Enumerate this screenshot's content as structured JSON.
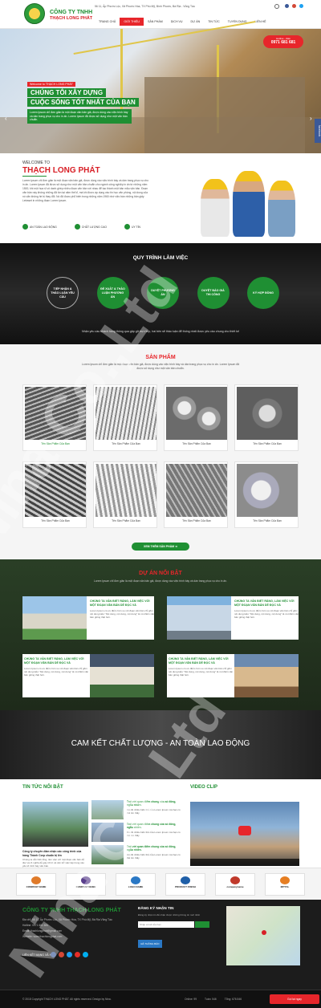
{
  "header": {
    "brand_line1": "CÔNG TY TNHH",
    "brand_line2": "THẠCH LONG PHÁT",
    "address": "56 11, Ấp Phước Lộc, Xã Phước Hòa, TX Phú Mỹ, Bình Phước, Bà Rịa - Vũng Tàu",
    "nav": [
      "TRANG CHỦ",
      "GIỚI THIỆU",
      "SẢN PHẨM",
      "DỊCH VỤ",
      "DỰ ÁN",
      "TIN TỨC",
      "TUYỂN DỤNG",
      "LIÊN HỆ"
    ]
  },
  "hero": {
    "hotline_label": "Hotline - Zalo",
    "hotline_number": "0971 681 681",
    "welcome": "Welcome to THẠCH LONG PHÁT",
    "title1": "CHÚNG TÔI XÂY DỰNG",
    "title2": "CUỘC SỐNG TỐT NHẤT CỦA BẠN",
    "desc": "Lorem Ipsum chỉ đơn giản là một đoạn văn bản giả, được dùng vào việc trình bày và dàn trang phục vụ cho in ấn. Lorem Ipsum đã được sử dụng như một văn bản chuẩn.",
    "facebook_tab": "facebook"
  },
  "welcome": {
    "sub": "WELCOME TO",
    "title": "THẠCH LONG PHÁT",
    "text": "Lorem Ipsum chỉ đơn giản là một đoạn văn bản giả, được dùng vào việc trình bày và dàn trang phục vụ cho in ấn. Lorem Ipsum đã được sử dụng như một văn bản chuẩn cho ngành công nghiệp in ấn từ những năm 1500, khi một họa sĩ vô danh ghép nhiều đoạn văn bản với nhau để tạo thành một bản mẫu văn bản. Đoạn văn bản này không những đã tồn tại năm thế kỉ, mà khi được áp dụng vào tin học văn phòng, nội dung của nó vẫn không hề bị thay đổi. Nó đã được phổ biến trong những năm 1960 nhờ việc bán những bản giấy Letraset in những đoạn Lorem Ipsum.",
    "icons": [
      "AN TOÀN LAO ĐỘNG",
      "CHẤT LƯỢNG CAO",
      "UY TÍN"
    ]
  },
  "process": {
    "title": "QUY TRÌNH LÀM VIỆC",
    "steps": [
      "TIẾP NHẬN & THẢO LUẬN YÊU CẦU",
      "ĐỀ XUẤT & THẢO LUẬN PHƯƠNG ÁN",
      "DUYỆT PHƯƠNG ÁN",
      "DUYỆT BÁO GIÁ THI CÔNG",
      "KÝ HỢP ĐỒNG"
    ],
    "note": "Nhận yêu cầu khách hàng thông qua gặp gỡ trực tiếp, hai bên sẽ thảo luận để thống nhất được yêu cầu chung cho thiết kế"
  },
  "products": {
    "title": "SẢN PHẨM",
    "desc": "Lorem Ipsum chỉ đơn giản là một đoạn văn bản giả, được dùng vào việc trình bày và dàn trang phục vụ cho in ấn. Lorem Ipsum đã được sử dụng như một văn bản chuẩn.",
    "items": [
      "Tên Sản Phẩm Của Bạn",
      "Tên Sản Phẩm Của Bạn",
      "Tên Sản Phẩm Của Bạn",
      "Tên Sản Phẩm Của Bạn",
      "Tên Sản Phẩm Của Bạn",
      "Tên Sản Phẩm Của Bạn",
      "Tên Sản Phẩm Của Bạn",
      "Tên Sản Phẩm Của Bạn"
    ],
    "button": "XEM THÊM SẢN PHẨM ➜"
  },
  "projects": {
    "title": "DỰ ÁN NỔI BẬT",
    "desc": "Lorem Ipsum chỉ đơn giản là một đoạn văn bản giả, được dùng vào việc trình bày và dàn trang phục vụ cho in ấn.",
    "items": [
      {
        "title": "CHÚNG TA VẪN BIẾT RẰNG, LÀM VIỆC VỚI MỘT ĐOẠN VĂN BẢN DỄ ĐỌC VÀ",
        "desc": "Lorem Ipsum có ưu điểm hơn so với đoạn văn bản chỉ gồm nội dung kiểu \"Nội dung, nội dung, nội dung\" là nó khiến văn bản giống thật hơn.",
        "button": "Xem Thêm"
      },
      {
        "title": "CHÚNG TA VẪN BIẾT RẰNG, LÀM VIỆC VỚI MỘT ĐOẠN VĂN BẢN DỄ ĐỌC VÀ",
        "desc": "Lorem Ipsum có ưu điểm hơn so với đoạn văn bản chỉ gồm nội dung kiểu \"Nội dung, nội dung, nội dung\" là nó khiến văn bản giống thật hơn.",
        "button": "Xem Thêm"
      },
      {
        "title": "CHÚNG TA VẪN BIẾT RẰNG, LÀM VIỆC VỚI MỘT ĐOẠN VĂN BẢN DỄ ĐỌC VÀ",
        "desc": "Lorem Ipsum có ưu điểm hơn so với đoạn văn bản chỉ gồm nội dung kiểu \"Nội dung, nội dung, nội dung\" là nó khiến văn bản giống thật hơn.",
        "button": "Xem Thêm"
      },
      {
        "title": "CHÚNG TA VẪN BIẾT RẰNG, LÀM VIỆC VỚI MỘT ĐOẠN VĂN BẢN DỄ ĐỌC VÀ",
        "desc": "Lorem Ipsum có ưu điểm hơn so với đoạn văn bản chỉ gồm nội dung kiểu \"Nội dung, nội dung, nội dung\" là nó khiến văn bản giống thật hơn.",
        "button": "Xem Thêm"
      }
    ]
  },
  "commitment": {
    "text": "CAM KẾT CHẤT LƯỢNG - AN TOÀN LAO ĐỘNG"
  },
  "news": {
    "title": "TIN TỨC NỔI BẬT",
    "main_title": "Công ty chuyên đảm nhận các công trình của hàng Thành Corp chuẩn bị lên",
    "main_desc": "Chúng ta vẫn biết rằng, làm việc với một đoạn văn bản dễ đọc và rõ nghĩa dễ gây rối trí và cản trở việc tập trung vào yếu tố trình bày văn bản.",
    "items": [
      {
        "title": "Trái với quan điểm chung của số đông, ngẫu nhiên.",
        "desc": "Có rất nhiều biến thể của Lorem Ipsum mà bạn có thể tìm thấy"
      },
      {
        "title": "Trái với quan điểm chung của số đông, ngẫu nhiên.",
        "desc": "Có rất nhiều biến thể của Lorem Ipsum mà bạn có thể tìm thấy"
      },
      {
        "title": "Trái với quan điểm chung của số đông, ngẫu nhiên.",
        "desc": "Có rất nhiều biến thể của Lorem Ipsum mà bạn có thể tìm thấy"
      },
      {
        "title": "Trái với quan điểm chung của số đông, ngẫu nhiên.",
        "desc": "Có rất nhiều biến thể của Lorem Ipsum mà bạn có thể tìm thấy"
      }
    ]
  },
  "video": {
    "title": "VIDEO CLIP"
  },
  "partners": [
    "COMPANY NAME",
    "COMPANY NAME",
    "LOGO NAME",
    "PRODUCT FRESH",
    "companyname",
    "MITTAL"
  ],
  "footer": {
    "title": "CÔNG TY TNHH THẠCH LONG PHÁT",
    "lines": [
      "Địa chỉ: 56 11, Ấp Phước Lộc, Xã Phước Hòa, TX Phú Mỹ, Bà Rịa Vũng Tàu",
      "Hotline: 0971 681 681",
      "Email: thachlongphat@gmail.com",
      "Website: www.thachlongphat.com"
    ],
    "links_label": "LIÊN KẾT MẠNG XÃ HỘI",
    "subscribe_title": "ĐĂNG KÝ NHẬN TIN",
    "subscribe_desc": "Đăng ký nhận tin để nhận được những thông tin mới nhất",
    "email_placeholder": "Nhập email của bạn",
    "badge": "ĐÃ THÔNG BÁO"
  },
  "bottom": {
    "copyright": "© 2018 Copyright THẠCH LONG PHÁT. All rights reserved. Design by Nina.",
    "online": "Online: 99",
    "week": "Tuần: 546",
    "total": "Tổng: 676.546",
    "hotline": "Gọi lại ngay"
  },
  "watermark": "Nina Co.,Ltd",
  "colors": {
    "green": "#1f8f33",
    "red": "#e7262b",
    "dark": "#1c1c1c"
  }
}
